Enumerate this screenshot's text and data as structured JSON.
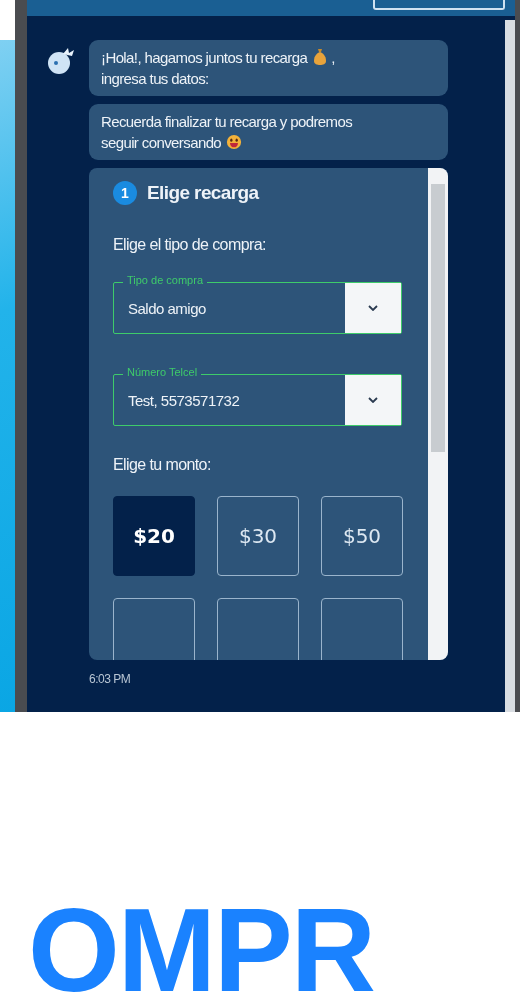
{
  "messages": [
    {
      "lines": [
        "¡Hola!, hagamos juntos tu recarga",
        ","
      ],
      "after": "ingresa tus datos:"
    },
    {
      "lines": [
        "Recuerda finalizar tu recarga y podremos",
        "seguir conversando"
      ]
    }
  ],
  "card": {
    "step": {
      "number": "1",
      "title": "Elige recarga"
    },
    "purchase_prompt": "Elige el tipo de compra:",
    "fields": [
      {
        "label": "Tipo de compra",
        "value": "Saldo amigo"
      },
      {
        "label": "Número Telcel",
        "value": "Test, 5573571732"
      }
    ],
    "amount_prompt": "Elige tu monto:",
    "amounts": [
      {
        "label": "$20",
        "selected": true
      },
      {
        "label": "$30",
        "selected": false
      },
      {
        "label": "$50",
        "selected": false
      }
    ]
  },
  "time": "6:03 PM",
  "banner": "OMPR"
}
